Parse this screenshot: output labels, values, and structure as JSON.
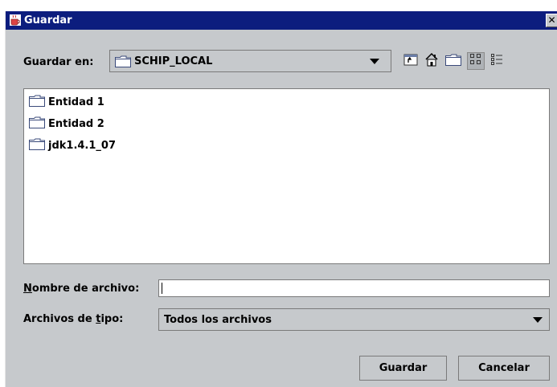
{
  "window": {
    "title": "Guardar",
    "close_glyph": "✕"
  },
  "save_in": {
    "label": "Guardar en:",
    "value": "SCHIP_LOCAL"
  },
  "toolbar": {
    "buttons": [
      {
        "name": "up-one-level",
        "icon": "folder-up-icon"
      },
      {
        "name": "home",
        "icon": "home-icon"
      },
      {
        "name": "new-folder",
        "icon": "new-folder-icon"
      },
      {
        "name": "list-view",
        "icon": "list-view-icon",
        "active": true
      },
      {
        "name": "details-view",
        "icon": "details-view-icon"
      }
    ]
  },
  "files": [
    {
      "name": "Entidad 1",
      "icon": "folder-icon"
    },
    {
      "name": "Entidad 2",
      "icon": "folder-icon"
    },
    {
      "name": "jdk1.4.1_07",
      "icon": "folder-icon"
    }
  ],
  "filename": {
    "label_mnemonic": "N",
    "label_rest": "ombre de archivo:",
    "value": ""
  },
  "filetype": {
    "label_pre": "Archivos de ",
    "label_mnemonic": "t",
    "label_post": "ipo:",
    "value": "Todos los archivos"
  },
  "buttons": {
    "save": "Guardar",
    "cancel": "Cancelar"
  },
  "colors": {
    "title_bar": "#0c1d7e",
    "dialog_bg": "#c6c9cc"
  }
}
